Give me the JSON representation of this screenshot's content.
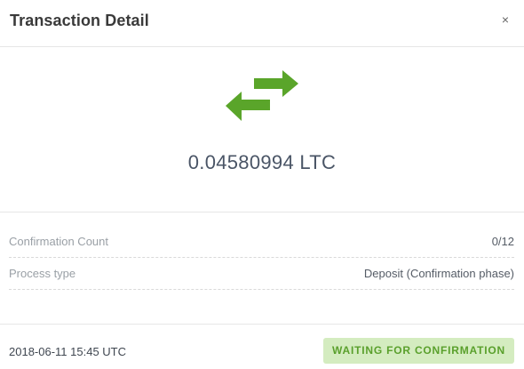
{
  "modal": {
    "title": "Transaction Detail",
    "close_label": "×"
  },
  "hero": {
    "icon": "transfer-arrows-icon",
    "icon_color": "#5aa52a",
    "amount": "0.04580994 LTC"
  },
  "details": {
    "rows": [
      {
        "label": "Confirmation Count",
        "value": "0/12"
      },
      {
        "label": "Process type",
        "value": "Deposit (Confirmation phase)"
      }
    ]
  },
  "footer": {
    "timestamp": "2018-06-11 15:45 UTC",
    "status": "WAITING FOR CONFIRMATION",
    "status_bg": "#d4ecc0",
    "status_color": "#5aa02c"
  }
}
